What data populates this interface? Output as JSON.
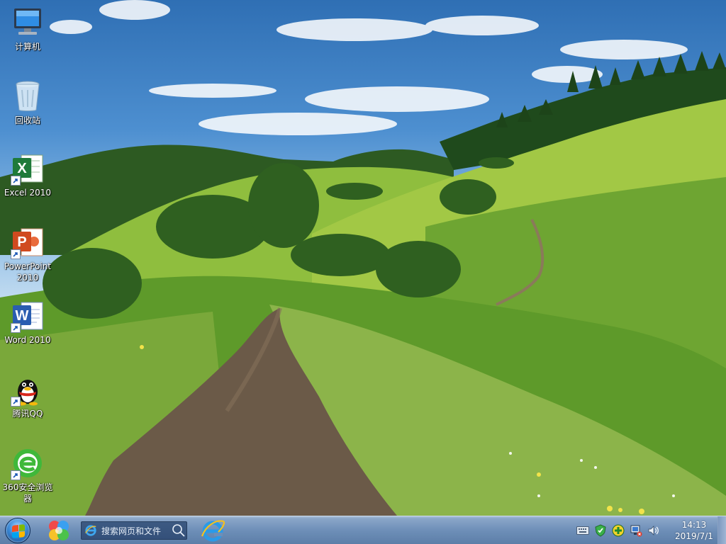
{
  "desktop": {
    "icons": [
      {
        "label": "计算机",
        "icon": "computer-icon"
      },
      {
        "label": "回收站",
        "icon": "recycle-bin-icon"
      },
      {
        "label": "Excel 2010",
        "icon": "excel-icon"
      },
      {
        "label": "PowerPoint 2010",
        "icon": "powerpoint-icon"
      },
      {
        "label": "Word 2010",
        "icon": "word-icon"
      },
      {
        "label": "腾讯QQ",
        "icon": "qq-penguin-icon"
      },
      {
        "label": "360安全浏览器",
        "icon": "browser-360-icon"
      }
    ]
  },
  "taskbar": {
    "start_icon": "windows-start-icon",
    "search": {
      "placeholder": "搜索网页和文件",
      "icon": "ie-icon",
      "button_icon": "search-icon"
    },
    "pinned": [
      "colorful-app-icon",
      "internet-explorer-icon"
    ],
    "tray_icons": [
      "keyboard-icon",
      "security-shield-icon",
      "plus-icon",
      "network-icon",
      "volume-icon"
    ],
    "clock": {
      "time": "14:13",
      "date": "2019/7/1"
    }
  },
  "colors": {
    "taskbar_top": "#8aa6c8",
    "taskbar_bottom": "#5c7ea8",
    "sky": "#4d8fd0",
    "grass": "#7fb23a"
  }
}
